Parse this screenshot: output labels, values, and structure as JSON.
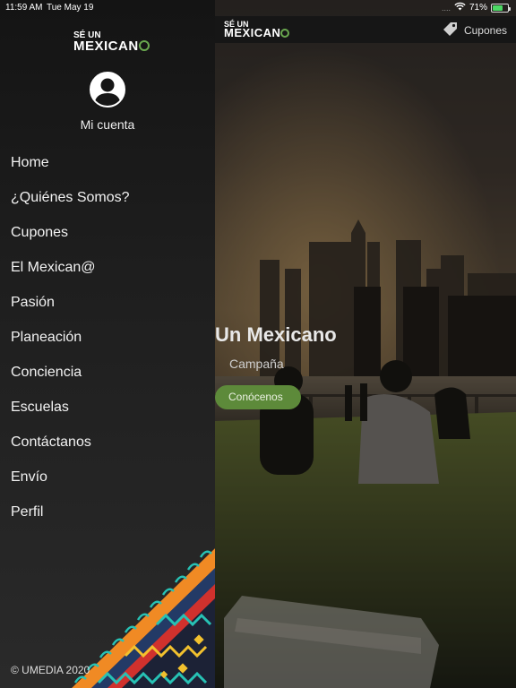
{
  "status_bar": {
    "time": "11:59 AM",
    "date": "Tue May 19",
    "cellular": "....",
    "battery_text": "71%",
    "battery_level": 0.71
  },
  "drawer": {
    "logo_line1": "SÉ UN",
    "logo_line2_pre": "MEXICAN",
    "account_label": "Mi cuenta",
    "menu": [
      {
        "label": "Home"
      },
      {
        "label": "¿Quiénes Somos?"
      },
      {
        "label": "Cupones"
      },
      {
        "label": "El Mexican@"
      },
      {
        "label": "Pasión"
      },
      {
        "label": "Planeación"
      },
      {
        "label": "Conciencia"
      },
      {
        "label": "Escuelas"
      },
      {
        "label": "Contáctanos"
      },
      {
        "label": "Envío"
      },
      {
        "label": "Perfil"
      }
    ],
    "footer": "© UMEDIA 2020"
  },
  "main": {
    "logo_line1": "SÉ UN",
    "logo_line2_pre": "MEXICAN",
    "coupons_label": "Cupones",
    "hero_title": "Un Mexicano",
    "hero_subtitle": "Campaña",
    "hero_button": "Conócenos"
  },
  "colors": {
    "accent_green": "#5d8a3a",
    "logo_ring": "#6aa84f",
    "battery": "#4cd964"
  },
  "icons": [
    "wifi-icon",
    "battery-icon",
    "tag-icon",
    "user-icon"
  ]
}
